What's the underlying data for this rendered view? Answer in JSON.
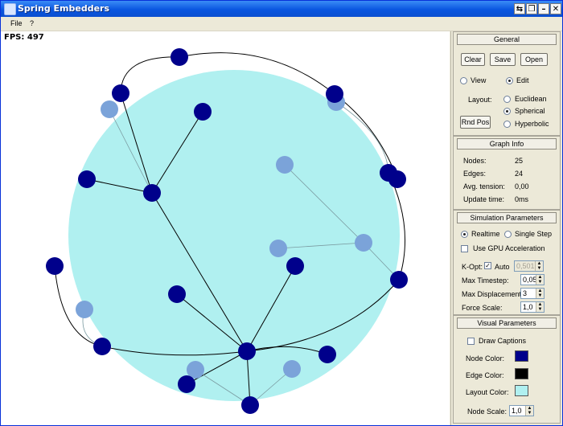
{
  "window": {
    "title": "Spring Embedders"
  },
  "menu": {
    "file": "File",
    "help": "?"
  },
  "canvas": {
    "fps_label": "FPS:",
    "fps_value": "497"
  },
  "general": {
    "title": "General",
    "clear": "Clear",
    "save": "Save",
    "open": "Open",
    "view": "View",
    "edit": "Edit",
    "layout_label": "Layout:",
    "euclidean": "Euclidean",
    "spherical": "Spherical",
    "hyperbolic": "Hyperbolic",
    "rnd_pos": "Rnd Pos"
  },
  "graph_info": {
    "title": "Graph Info",
    "nodes_label": "Nodes:",
    "nodes": "25",
    "edges_label": "Edges:",
    "edges": "24",
    "tension_label": "Avg. tension:",
    "tension": "0,00",
    "update_label": "Update time:",
    "update": "0ms"
  },
  "simulation": {
    "title": "Simulation Parameters",
    "realtime": "Realtime",
    "single_step": "Single Step",
    "gpu": "Use GPU Acceleration",
    "kopt_label": "K-Opt:",
    "auto": "Auto",
    "kopt_value": "0,501",
    "timestep_label": "Max Timestep:",
    "timestep": "0,05",
    "displacement_label": "Max Displacement:",
    "displacement": "3",
    "force_label": "Force Scale:",
    "force": "1,0"
  },
  "visual": {
    "title": "Visual Parameters",
    "captions": "Draw Captions",
    "node_color_label": "Node Color:",
    "edge_color_label": "Edge Color:",
    "layout_color_label": "Layout Color:",
    "node_scale_label": "Node Scale:",
    "node_scale": "1,0"
  },
  "colors": {
    "node": "#00008b",
    "edge": "#000000",
    "layout": "#b0f0f0",
    "back_node": "#7ba3d9"
  }
}
